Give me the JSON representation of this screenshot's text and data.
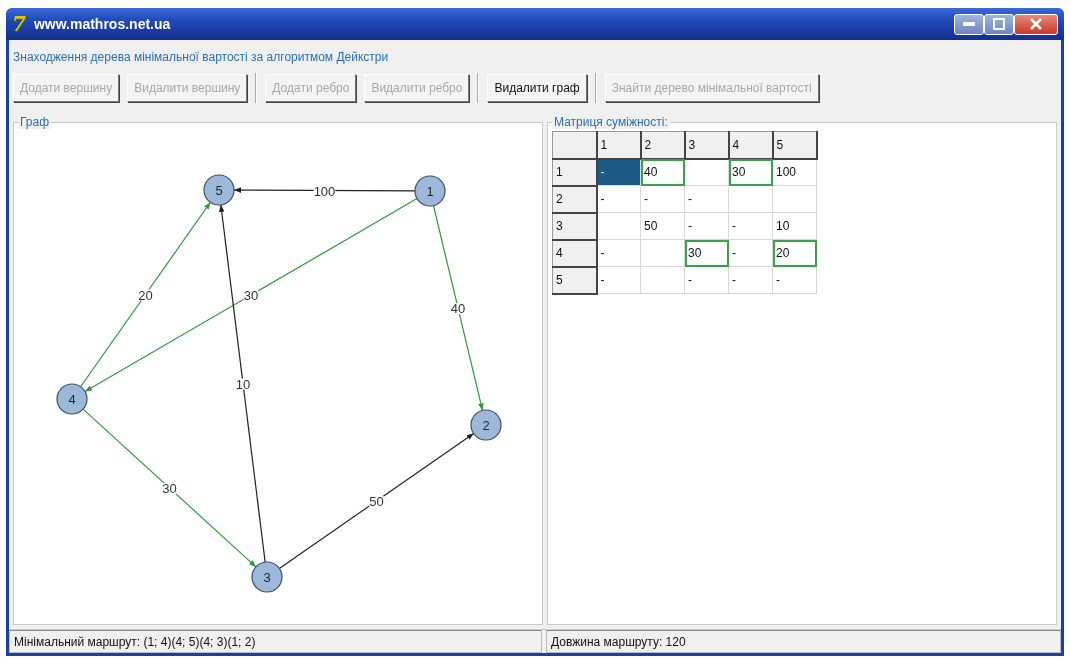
{
  "window": {
    "logo": "7",
    "title": "www.mathros.net.ua"
  },
  "subtitle": "Знаходження дерева мінімальної вартості за алгоритмом Дейкстри",
  "toolbar": [
    [
      {
        "label": "Додати вершину",
        "disabled": true
      },
      {
        "label": "Видалити вершину",
        "disabled": true
      }
    ],
    [
      {
        "label": "Додати ребро",
        "disabled": true
      },
      {
        "label": "Видалити ребро",
        "disabled": true
      }
    ],
    [
      {
        "label": "Видалити граф",
        "disabled": false
      }
    ],
    [
      {
        "label": "Знайти дерево мінімальної вартості",
        "disabled": true
      }
    ]
  ],
  "graph": {
    "title": "Граф",
    "nodes": [
      {
        "label": "1"
      },
      {
        "label": "2"
      },
      {
        "label": "3"
      },
      {
        "label": "4"
      },
      {
        "label": "5"
      }
    ],
    "edges": [
      {
        "weight": "100",
        "in_tree": false
      },
      {
        "weight": "30",
        "in_tree": true
      },
      {
        "weight": "40",
        "in_tree": true
      },
      {
        "weight": "20",
        "in_tree": true
      },
      {
        "weight": "10",
        "in_tree": false
      },
      {
        "weight": "30",
        "in_tree": true
      },
      {
        "weight": "50",
        "in_tree": false
      }
    ]
  },
  "matrix": {
    "title": "Матриця суміжності:",
    "columns": [
      "1",
      "2",
      "3",
      "4",
      "5"
    ],
    "rows": [
      {
        "header": "1",
        "cells": [
          {
            "text": "-",
            "selected": true,
            "in_tree": false
          },
          {
            "text": "40",
            "selected": false,
            "in_tree": true
          },
          {
            "text": "",
            "selected": false,
            "in_tree": false
          },
          {
            "text": "30",
            "selected": false,
            "in_tree": true
          },
          {
            "text": "100",
            "selected": false,
            "in_tree": false
          }
        ]
      },
      {
        "header": "2",
        "cells": [
          {
            "text": "-",
            "selected": false,
            "in_tree": false
          },
          {
            "text": "-",
            "selected": false,
            "in_tree": false
          },
          {
            "text": "-",
            "selected": false,
            "in_tree": false
          },
          {
            "text": "",
            "selected": false,
            "in_tree": false
          },
          {
            "text": "",
            "selected": false,
            "in_tree": false
          }
        ]
      },
      {
        "header": "3",
        "cells": [
          {
            "text": "",
            "selected": false,
            "in_tree": false
          },
          {
            "text": "50",
            "selected": false,
            "in_tree": false
          },
          {
            "text": "-",
            "selected": false,
            "in_tree": false
          },
          {
            "text": "-",
            "selected": false,
            "in_tree": false
          },
          {
            "text": "10",
            "selected": false,
            "in_tree": false
          }
        ]
      },
      {
        "header": "4",
        "cells": [
          {
            "text": "-",
            "selected": false,
            "in_tree": false
          },
          {
            "text": "",
            "selected": false,
            "in_tree": false
          },
          {
            "text": "30",
            "selected": false,
            "in_tree": true
          },
          {
            "text": "-",
            "selected": false,
            "in_tree": false
          },
          {
            "text": "20",
            "selected": false,
            "in_tree": true
          }
        ]
      },
      {
        "header": "5",
        "cells": [
          {
            "text": "-",
            "selected": false,
            "in_tree": false
          },
          {
            "text": "",
            "selected": false,
            "in_tree": false
          },
          {
            "text": "-",
            "selected": false,
            "in_tree": false
          },
          {
            "text": "-",
            "selected": false,
            "in_tree": false
          },
          {
            "text": "-",
            "selected": false,
            "in_tree": false
          }
        ]
      }
    ]
  },
  "status_bar": [
    "Мінімальний маршрут: (1; 4)(4; 5)(4; 3)(1; 2)",
    "Довжина маршруту: 120"
  ]
}
